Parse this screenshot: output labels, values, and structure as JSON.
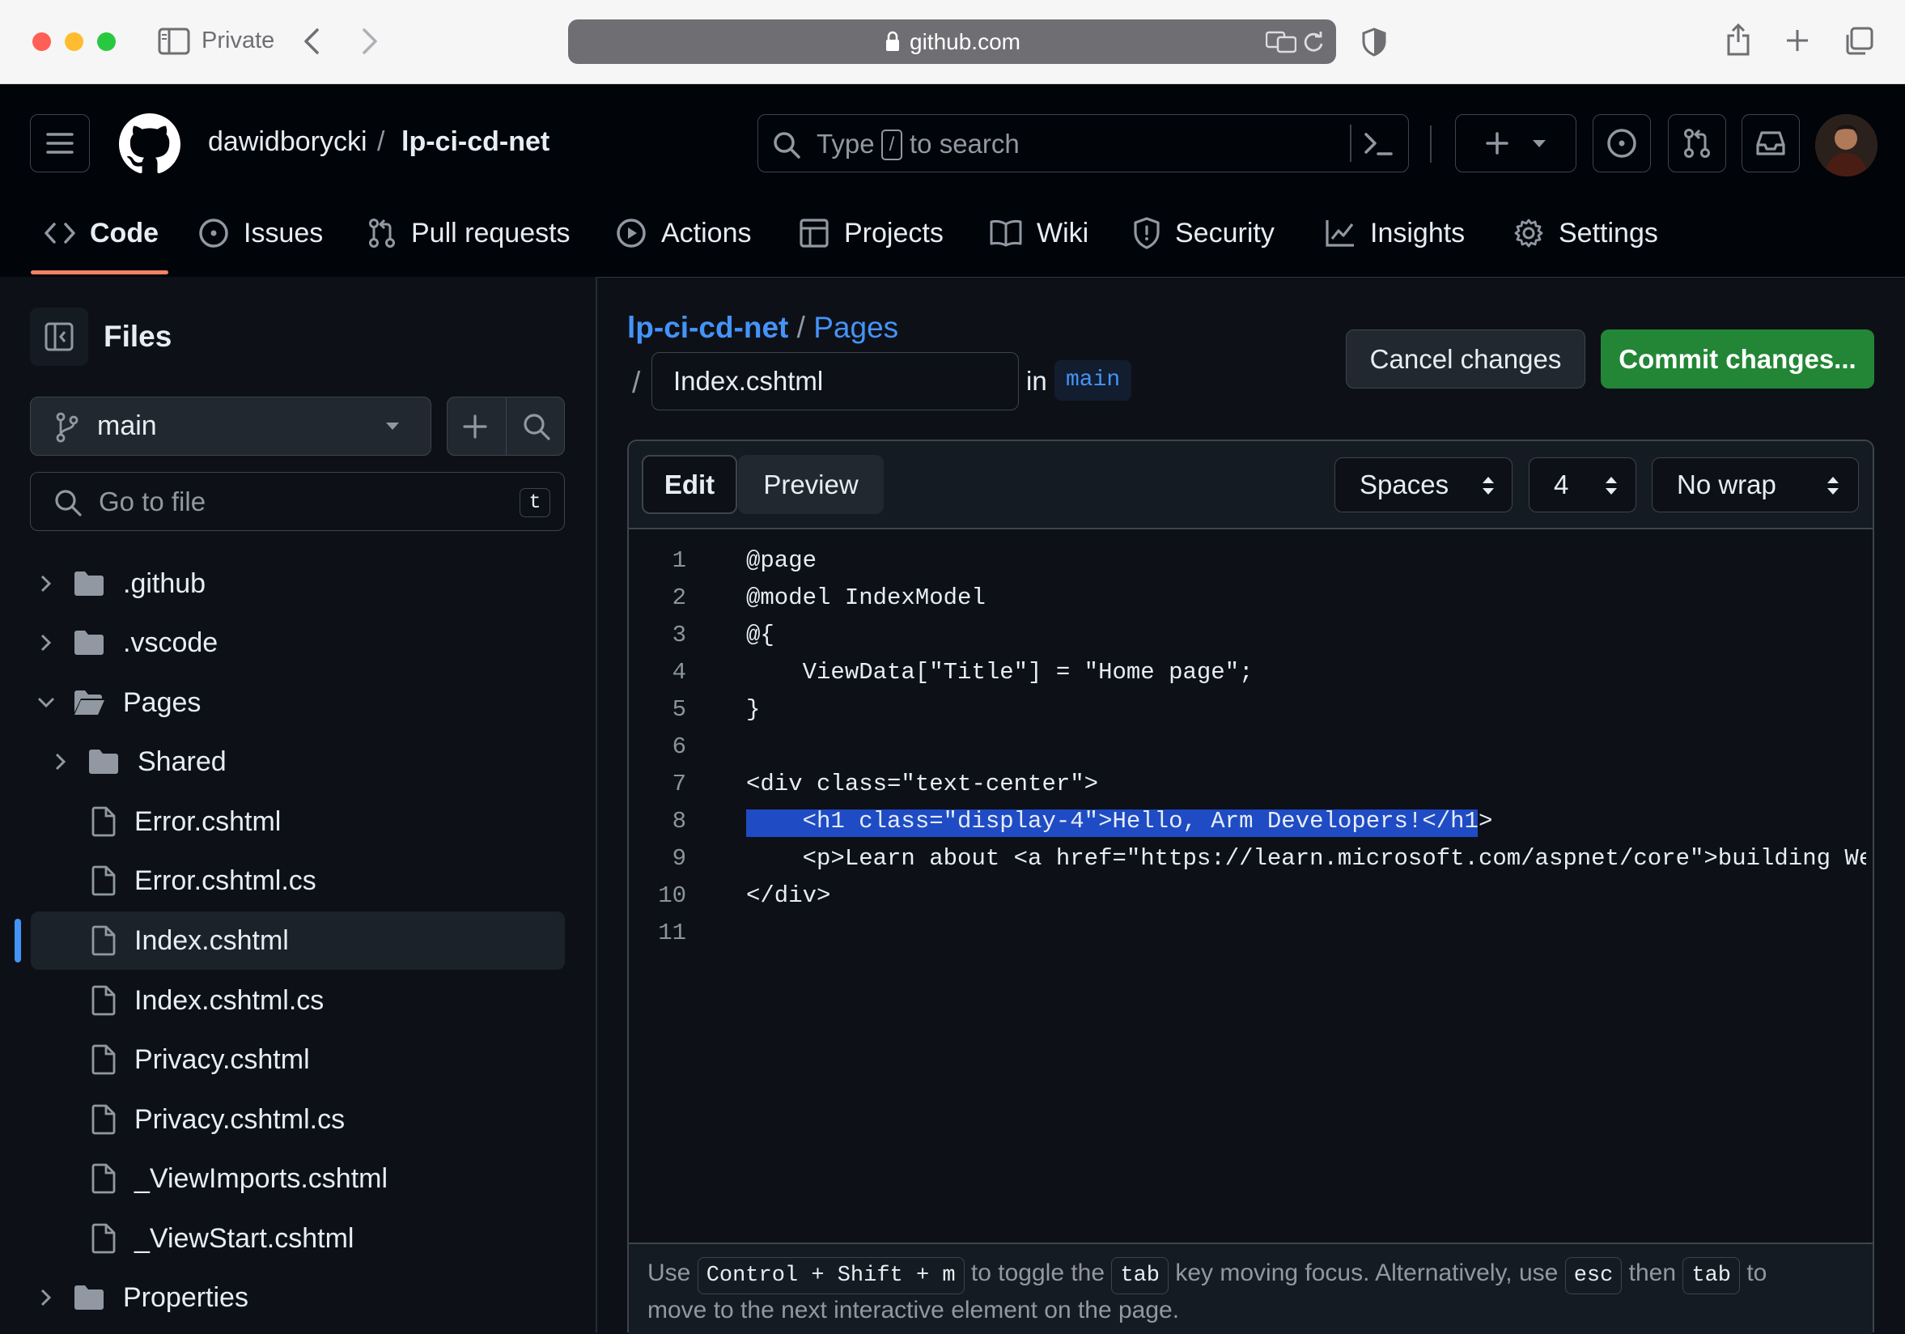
{
  "browser": {
    "private_label": "Private",
    "url": "github.com"
  },
  "header": {
    "owner": "dawidborycki",
    "separator": "/",
    "repo": "lp-ci-cd-net",
    "search_prefix": "Type",
    "search_key": "/",
    "search_suffix": "to search"
  },
  "repo_nav": {
    "tabs": [
      {
        "label": "Code",
        "icon": "code-icon",
        "active": true
      },
      {
        "label": "Issues",
        "icon": "issue-icon"
      },
      {
        "label": "Pull requests",
        "icon": "pull-request-icon"
      },
      {
        "label": "Actions",
        "icon": "play-icon"
      },
      {
        "label": "Projects",
        "icon": "table-icon"
      },
      {
        "label": "Wiki",
        "icon": "book-icon"
      },
      {
        "label": "Security",
        "icon": "shield-icon"
      },
      {
        "label": "Insights",
        "icon": "graph-icon"
      },
      {
        "label": "Settings",
        "icon": "gear-icon"
      }
    ]
  },
  "sidebar": {
    "title": "Files",
    "branch": "main",
    "go_to_file_placeholder": "Go to file",
    "go_to_file_key": "t",
    "tree": [
      {
        "label": ".github",
        "type": "folder",
        "state": "collapsed"
      },
      {
        "label": ".vscode",
        "type": "folder",
        "state": "collapsed"
      },
      {
        "label": "Pages",
        "type": "folder",
        "state": "expanded"
      },
      {
        "label": "Shared",
        "type": "folder",
        "state": "collapsed"
      },
      {
        "label": "Error.cshtml",
        "type": "file"
      },
      {
        "label": "Error.cshtml.cs",
        "type": "file"
      },
      {
        "label": "Index.cshtml",
        "type": "file",
        "selected": true
      },
      {
        "label": "Index.cshtml.cs",
        "type": "file"
      },
      {
        "label": "Privacy.cshtml",
        "type": "file"
      },
      {
        "label": "Privacy.cshtml.cs",
        "type": "file"
      },
      {
        "label": "_ViewImports.cshtml",
        "type": "file"
      },
      {
        "label": "_ViewStart.cshtml",
        "type": "file"
      },
      {
        "label": "Properties",
        "type": "folder",
        "state": "collapsed"
      }
    ]
  },
  "editor": {
    "breadcrumb_repo": "lp-ci-cd-net",
    "breadcrumb_sep": "/",
    "breadcrumb_folder": "Pages",
    "path_sep": "/",
    "filename": "Index.cshtml",
    "in_label": "in",
    "branch": "main",
    "cancel_label": "Cancel changes",
    "commit_label": "Commit changes...",
    "edit_tab": "Edit",
    "preview_tab": "Preview",
    "indent_mode": "Spaces",
    "indent_size": "4",
    "wrap_mode": "No wrap",
    "lines": [
      "@page",
      "@model IndexModel",
      "@{",
      "    ViewData[\"Title\"] = \"Home page\";",
      "}",
      "",
      "<div class=\"text-center\">",
      "    <h1 class=\"display-4\">Hello, Arm Developers!</h1>",
      "    <p>Learn about <a href=\"https://learn.microsoft.com/aspnet/core\">building Web",
      "</div>",
      ""
    ],
    "highlighted_line": 8,
    "help": {
      "t1": "Use",
      "k1": "Control + Shift + m",
      "t2": "to toggle the",
      "k2": "tab",
      "t3": "key moving focus. Alternatively, use",
      "k3": "esc",
      "t4": "then",
      "k4": "tab",
      "t5": "to",
      "t6": "move to the next interactive element on the page."
    }
  },
  "colors": {
    "accent_blue": "#4493f8",
    "commit_green": "#238636",
    "selection": "#1f4bc4",
    "active_tab_underline": "#f78166"
  }
}
